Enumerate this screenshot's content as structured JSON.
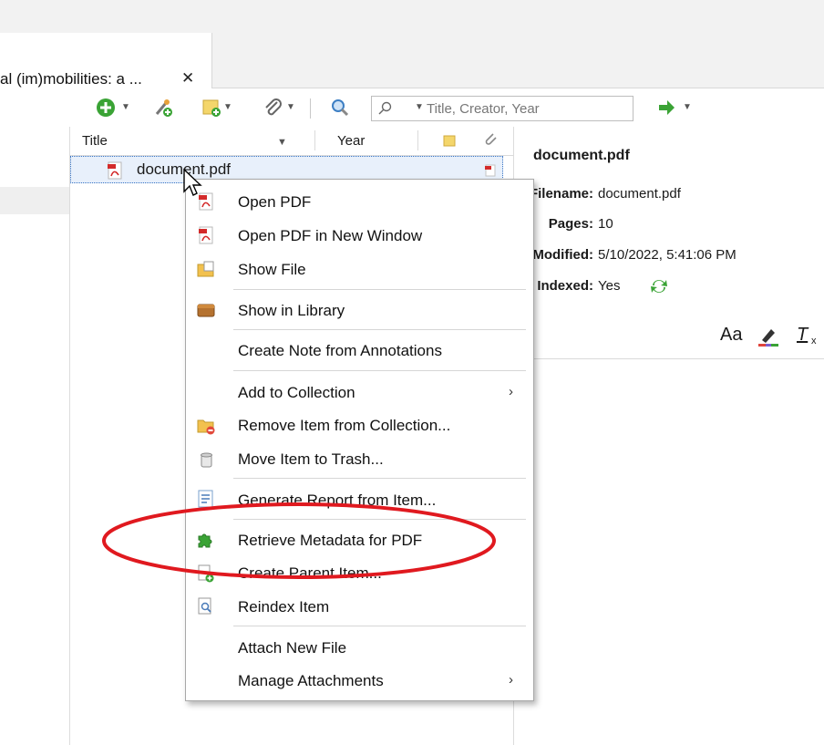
{
  "tab": {
    "title": "al (im)mobilities: a ...",
    "close": "✕"
  },
  "toolbar": {
    "search_placeholder": "Title, Creator, Year"
  },
  "columns": {
    "title": "Title",
    "year": "Year"
  },
  "item_row": {
    "name": "document.pdf"
  },
  "item_pane": {
    "title": "document.pdf",
    "fields": [
      {
        "label": "Filename:",
        "value": "document.pdf"
      },
      {
        "label": "Pages:",
        "value": "10"
      },
      {
        "label": "Modified:",
        "value": "5/10/2022, 5:41:06 PM"
      },
      {
        "label": "Indexed:",
        "value": "Yes"
      }
    ],
    "format_text": "Aa"
  },
  "context_menu": {
    "items": [
      "Open PDF",
      "Open PDF in New Window",
      "Show File",
      "Show in Library",
      "Create Note from Annotations",
      "Add to Collection",
      "Remove Item from Collection...",
      "Move Item to Trash...",
      "Generate Report from Item...",
      "Retrieve Metadata for PDF",
      "Create Parent Item...",
      "Reindex Item",
      "Attach New File",
      "Manage Attachments"
    ],
    "submenu_arrow": "›"
  },
  "colors": {
    "highlight_ellipse": "#e0191f",
    "selection": "#e8f0fb",
    "accent_green": "#3aa335"
  }
}
